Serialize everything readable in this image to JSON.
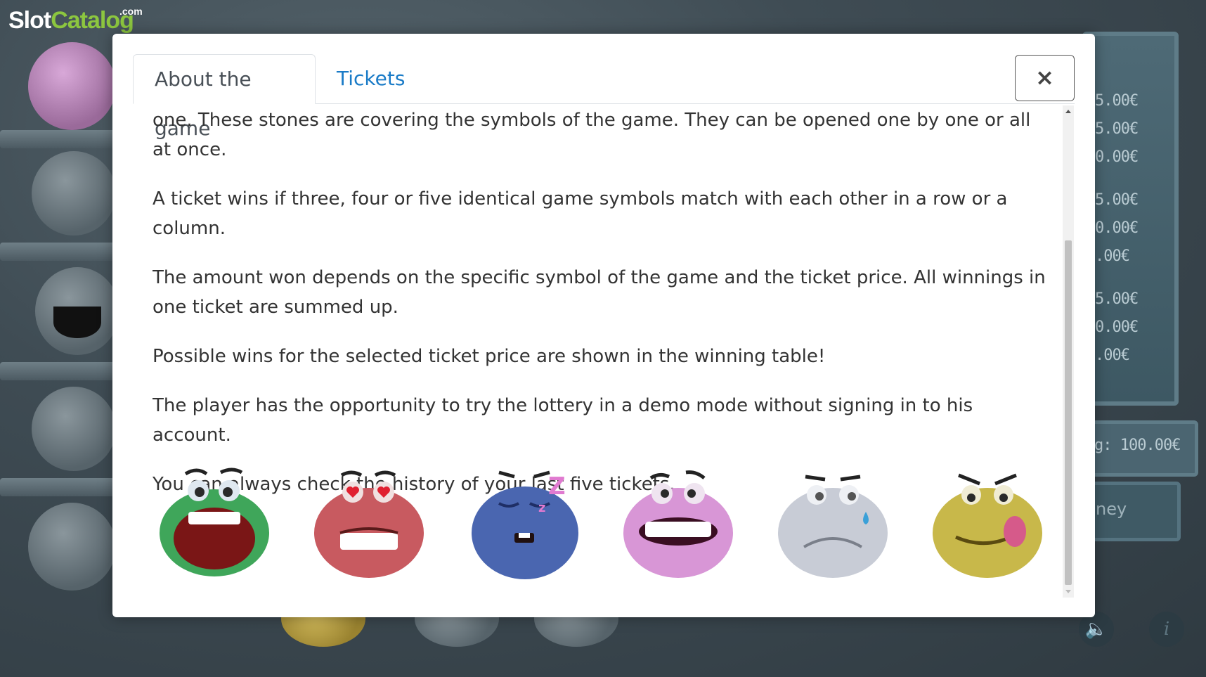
{
  "logo": {
    "slot": "Slot",
    "catalog": "Catalog",
    "com": ".com"
  },
  "background": {
    "prize_values": [
      "5.00€",
      "5.00€",
      "0.00€",
      "5.00€",
      "0.00€",
      ".00€",
      "5.00€",
      "0.00€",
      ".00€"
    ],
    "balance_text": "g: 100.00€",
    "money_text": "ney",
    "sound_icon": "speaker-icon",
    "info_icon": "info-icon"
  },
  "modal": {
    "tabs": [
      {
        "label": "About the game",
        "active": true
      },
      {
        "label": "Tickets",
        "active": false
      }
    ],
    "close_label": "×",
    "paragraphs": [
      "one. These stones are covering the symbols of the game. They can be opened one by one or all at once.",
      "A ticket wins if three, four or five identical game symbols match with each other in a row or a column.",
      "The amount won depends on the specific symbol of the game and the ticket price. All winnings in one ticket are summed up.",
      "Possible wins for the selected ticket price are shown in the winning table!",
      "The player has the opportunity to try the lottery in a demo mode without signing in to his account.",
      "You can always check the history of your last five tickets."
    ],
    "symbols": [
      {
        "name": "green-laughing-stone-icon",
        "color": "#3fa65a",
        "expression": "laugh"
      },
      {
        "name": "red-lovestruck-stone-icon",
        "color": "#c85a60",
        "expression": "love"
      },
      {
        "name": "blue-sleeping-stone-icon",
        "color": "#4a66b0",
        "expression": "sleep"
      },
      {
        "name": "pink-grinning-stone-icon",
        "color": "#d896d6",
        "expression": "grin"
      },
      {
        "name": "gray-worried-stone-icon",
        "color": "#c8ccd6",
        "expression": "worry"
      },
      {
        "name": "yellow-tongue-stone-icon",
        "color": "#c8b84a",
        "expression": "tongue"
      }
    ]
  }
}
